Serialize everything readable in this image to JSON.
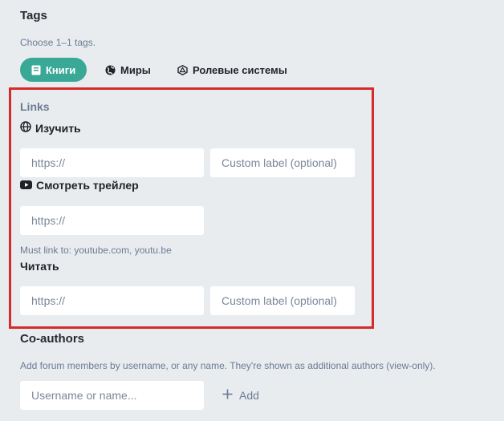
{
  "tags": {
    "title": "Tags",
    "hint": "Choose 1–1 tags.",
    "buttons": [
      {
        "label": "Книги",
        "icon": "book-icon",
        "active": true
      },
      {
        "label": "Миры",
        "icon": "globe-icon",
        "active": false
      },
      {
        "label": "Ролевые системы",
        "icon": "dice-icon",
        "active": false
      }
    ]
  },
  "links": {
    "title": "Links",
    "items": [
      {
        "title": "Изучить",
        "icon": "globe-icon",
        "url_placeholder": "https://",
        "label_placeholder": "Custom label (optional)"
      },
      {
        "title": "Смотреть трейлер",
        "icon": "youtube-icon",
        "url_placeholder": "https://",
        "hint": "Must link to: youtube.com, youtu.be"
      },
      {
        "title": "Читать",
        "url_placeholder": "https://",
        "label_placeholder": "Custom label (optional)"
      }
    ]
  },
  "coauthors": {
    "title": "Co-authors",
    "hint": "Add forum members by username, or any name. They're shown as additional authors (view-only).",
    "input_placeholder": "Username or name...",
    "add_label": "Add"
  },
  "colors": {
    "accent": "#3aa896",
    "highlight_border": "#d52b2b",
    "background": "#e9ecef"
  }
}
